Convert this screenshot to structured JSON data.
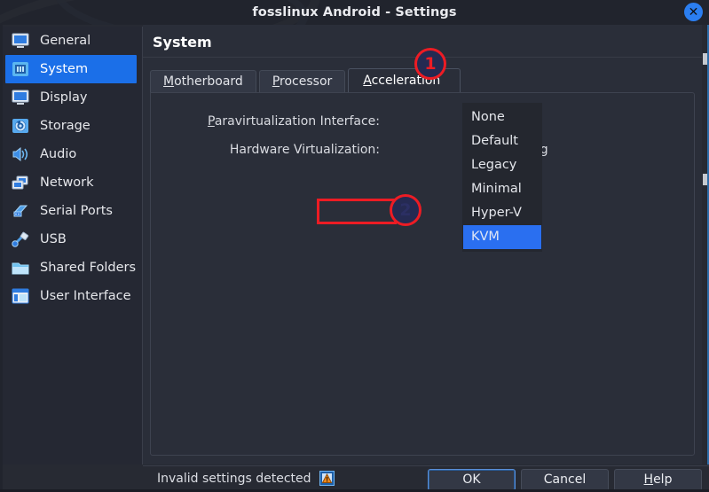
{
  "window": {
    "title": "fosslinux Android - Settings",
    "close_icon": "close-icon",
    "close_glyph": "✕"
  },
  "sidebar": {
    "items": [
      {
        "label": "General",
        "icon": "monitor-icon",
        "selected": false
      },
      {
        "label": "System",
        "icon": "chip-icon",
        "selected": true
      },
      {
        "label": "Display",
        "icon": "display-icon",
        "selected": false
      },
      {
        "label": "Storage",
        "icon": "storage-disk-icon",
        "selected": false
      },
      {
        "label": "Audio",
        "icon": "speaker-icon",
        "selected": false
      },
      {
        "label": "Network",
        "icon": "network-icon",
        "selected": false
      },
      {
        "label": "Serial Ports",
        "icon": "serial-port-icon",
        "selected": false
      },
      {
        "label": "USB",
        "icon": "usb-plug-icon",
        "selected": false
      },
      {
        "label": "Shared Folders",
        "icon": "folder-icon",
        "selected": false
      },
      {
        "label": "User Interface",
        "icon": "window-ui-icon",
        "selected": false
      }
    ]
  },
  "pane": {
    "title": "System",
    "tabs": [
      {
        "label": "Motherboard",
        "mnemonic": "M",
        "active": false
      },
      {
        "label": "Processor",
        "mnemonic": "P",
        "active": false
      },
      {
        "label": "Acceleration",
        "mnemonic": "A",
        "active": true
      }
    ],
    "fields": [
      {
        "label": "Paravirtualization Interface:",
        "mnemonic": "P",
        "value": ""
      },
      {
        "label": "Hardware Virtualization:",
        "mnemonic": "",
        "value": "sted Paging"
      }
    ]
  },
  "dropdown": {
    "name": "paravirtualization-interface-dropdown",
    "options": [
      {
        "label": "None",
        "selected": false
      },
      {
        "label": "Default",
        "selected": false
      },
      {
        "label": "Legacy",
        "selected": false
      },
      {
        "label": "Minimal",
        "selected": false
      },
      {
        "label": "Hyper-V",
        "selected": false
      },
      {
        "label": "KVM",
        "selected": true
      }
    ]
  },
  "annotations": [
    {
      "number": "1",
      "target": "acceleration-tab"
    },
    {
      "number": "2",
      "target": "kvm-option"
    }
  ],
  "bottom": {
    "status_text": "Invalid settings detected",
    "status_icon": "warning-icon",
    "buttons": [
      {
        "label": "OK",
        "mnemonic": "",
        "focused": true
      },
      {
        "label": "Cancel",
        "mnemonic": "",
        "focused": false
      },
      {
        "label": "Help",
        "mnemonic": "H",
        "focused": false
      }
    ]
  },
  "colors": {
    "accent_blue": "#1b6fe8",
    "select_blue": "#2a6ff0",
    "annotation_red": "#ed1c24",
    "window_bg": "#2a2e39",
    "sidebar_bg": "#252833",
    "titlebar_bg": "#21242d"
  }
}
